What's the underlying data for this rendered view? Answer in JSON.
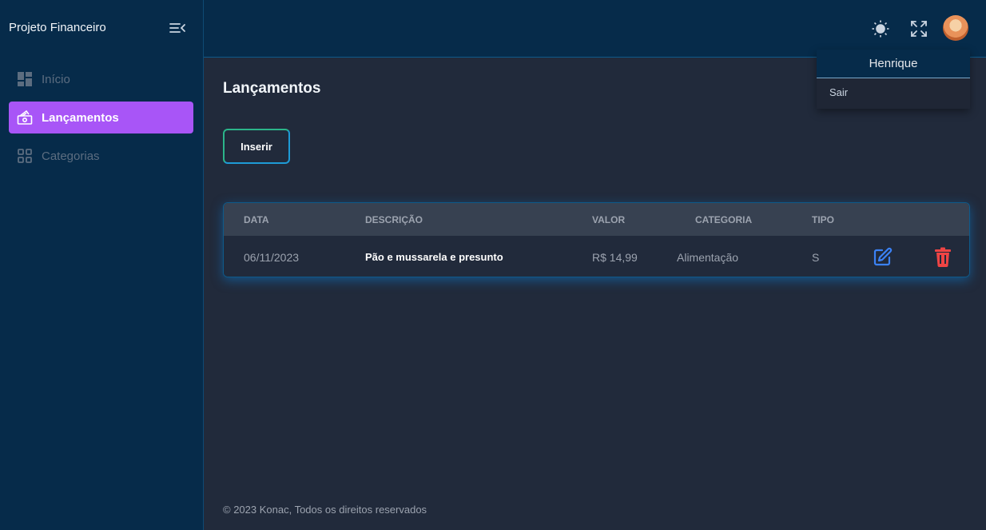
{
  "app": {
    "title": "Projeto Financeiro"
  },
  "sidebar": {
    "items": [
      {
        "label": "Início",
        "icon": "dashboard-icon"
      },
      {
        "label": "Lançamentos",
        "icon": "money-icon",
        "active": true
      },
      {
        "label": "Categorias",
        "icon": "grid-icon"
      }
    ]
  },
  "topbar": {
    "icons": [
      "sun-icon",
      "fullscreen-icon",
      "avatar"
    ]
  },
  "user_menu": {
    "name": "Henrique",
    "logout_label": "Sair"
  },
  "page": {
    "title": "Lançamentos",
    "insert_label": "Inserir"
  },
  "table": {
    "headers": [
      "DATA",
      "DESCRIÇÃO",
      "VALOR",
      "CATEGORIA",
      "TIPO"
    ],
    "rows": [
      {
        "date": "06/11/2023",
        "description": "Pão e mussarela e presunto",
        "value": "R$ 14,99",
        "category": "Alimentação",
        "type": "S"
      }
    ]
  },
  "footer": {
    "text": "© 2023 Konac, Todos os direitos reservados"
  },
  "colors": {
    "accent": "#a855f7",
    "edit": "#3b82f6",
    "delete": "#ef4444",
    "sidebar": "#062b4a",
    "background": "#212a3b"
  }
}
